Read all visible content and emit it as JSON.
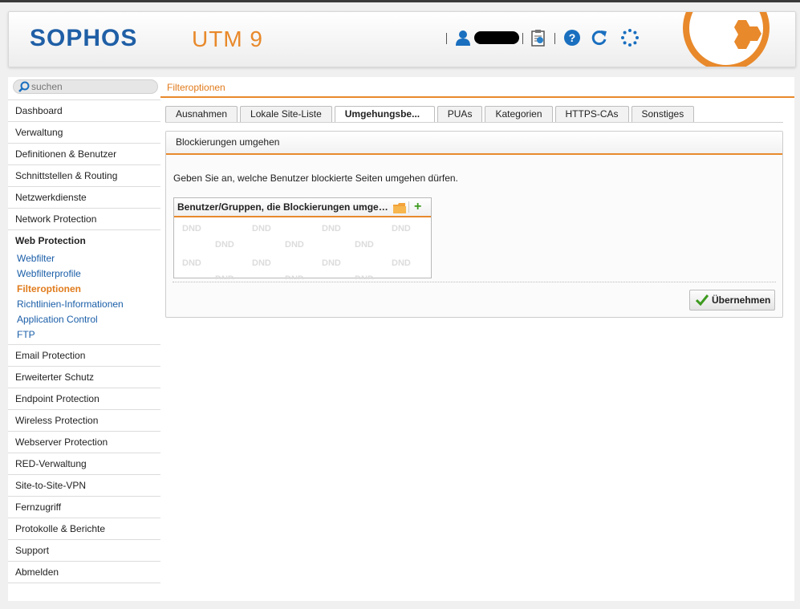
{
  "header": {
    "logo": "SOPHOS",
    "product": "UTM 9"
  },
  "search": {
    "placeholder": "suchen"
  },
  "page_title": "Filteroptionen",
  "sidebar": {
    "items_top": [
      "Dashboard",
      "Verwaltung",
      "Definitionen & Benutzer",
      "Schnittstellen & Routing",
      "Netzwerkdienste",
      "Network Protection"
    ],
    "active": "Web Protection",
    "sub_items": [
      "Webfilter",
      "Webfilterprofile",
      "Filteroptionen",
      "Richtlinien-Informationen",
      "Application Control",
      "FTP"
    ],
    "current_sub": "Filteroptionen",
    "items_bottom": [
      "Email Protection",
      "Erweiterter Schutz",
      "Endpoint Protection",
      "Wireless Protection",
      "Webserver Protection",
      "RED-Verwaltung",
      "Site-to-Site-VPN",
      "Fernzugriff",
      "Protokolle & Berichte",
      "Support",
      "Abmelden"
    ]
  },
  "tabs": [
    "Ausnahmen",
    "Lokale Site-Liste",
    "Umgehungsbe...",
    "PUAs",
    "Kategorien",
    "HTTPS-CAs",
    "Sonstiges"
  ],
  "active_tab": "Umgehungsbe...",
  "panel": {
    "title": "Blockierungen umgehen",
    "description": "Geben Sie an, welche Benutzer blockierte Seiten umgehen dürfen.",
    "list_title": "Benutzer/Gruppen, die Blockierungen umgeh...",
    "dnd_label": "DND",
    "add_symbol": "+",
    "apply_label": "Übernehmen"
  },
  "icons": {
    "user": "user-icon",
    "clipboard": "clipboard-icon",
    "help": "help-icon",
    "reload": "reload-icon",
    "spinner": "spinner-icon",
    "folder": "folder-icon",
    "add": "plus-icon",
    "check": "check-icon",
    "search": "search-icon"
  },
  "colors": {
    "accent": "#e8892b",
    "brand_blue": "#1f5fa6",
    "link": "#1a5ea8",
    "add_green": "#3d9a1f"
  }
}
